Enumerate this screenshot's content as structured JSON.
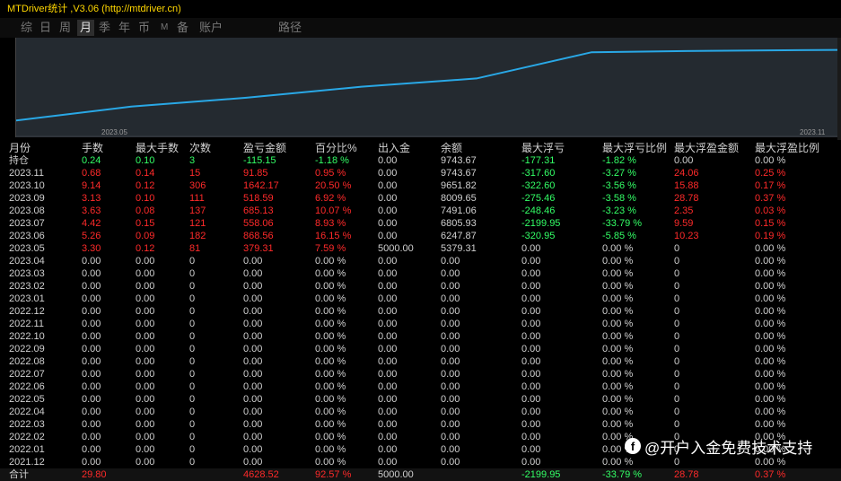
{
  "title": "MTDriver统计 ,V3.06 (http://mtdriver.cn)",
  "tabs": [
    "综",
    "日",
    "周",
    "月",
    "季",
    "年",
    "币",
    "M",
    "备",
    "账户",
    "路径"
  ],
  "active_tab": "月",
  "chart_data": {
    "type": "line",
    "x": [
      "2023.05",
      "2023.06",
      "2023.07",
      "2023.08",
      "2023.09",
      "2023.10",
      "2023.11"
    ],
    "y": [
      5379.31,
      6247.87,
      6805.93,
      7491.06,
      8009.65,
      9651.82,
      9743.67
    ],
    "xticks": [
      "2023.05",
      "2023.11"
    ],
    "color": "#29a8e6"
  },
  "table": {
    "headers": [
      "月份",
      "手数",
      "最大手数",
      "次数",
      "盈亏金额",
      "百分比%",
      "出入金",
      "余额",
      "最大浮亏",
      "最大浮亏比例",
      "最大浮盈金额",
      "最大浮盈比例"
    ],
    "rows": [
      [
        "持仓",
        "0.24",
        "0.10",
        "3",
        "-115.15",
        "-1.18 %",
        "0.00",
        "9743.67",
        "-177.31",
        "-1.82 %",
        "0.00",
        "0.00 %"
      ],
      [
        "2023.11",
        "0.68",
        "0.14",
        "15",
        "91.85",
        "0.95 %",
        "0.00",
        "9743.67",
        "-317.60",
        "-3.27 %",
        "24.06",
        "0.25 %"
      ],
      [
        "2023.10",
        "9.14",
        "0.12",
        "306",
        "1642.17",
        "20.50 %",
        "0.00",
        "9651.82",
        "-322.60",
        "-3.56 %",
        "15.88",
        "0.17 %"
      ],
      [
        "2023.09",
        "3.13",
        "0.10",
        "111",
        "518.59",
        "6.92 %",
        "0.00",
        "8009.65",
        "-275.46",
        "-3.58 %",
        "28.78",
        "0.37 %"
      ],
      [
        "2023.08",
        "3.63",
        "0.08",
        "137",
        "685.13",
        "10.07 %",
        "0.00",
        "7491.06",
        "-248.46",
        "-3.23 %",
        "2.35",
        "0.03 %"
      ],
      [
        "2023.07",
        "4.42",
        "0.15",
        "121",
        "558.06",
        "8.93 %",
        "0.00",
        "6805.93",
        "-2199.95",
        "-33.79 %",
        "9.59",
        "0.15 %"
      ],
      [
        "2023.06",
        "5.26",
        "0.09",
        "182",
        "868.56",
        "16.15 %",
        "0.00",
        "6247.87",
        "-320.95",
        "-5.85 %",
        "10.23",
        "0.19 %"
      ],
      [
        "2023.05",
        "3.30",
        "0.12",
        "81",
        "379.31",
        "7.59 %",
        "5000.00",
        "5379.31",
        "0.00",
        "0.00 %",
        "0",
        "0.00 %"
      ],
      [
        "2023.04",
        "0.00",
        "0.00",
        "0",
        "0.00",
        "0.00 %",
        "0.00",
        "0.00",
        "0.00",
        "0.00 %",
        "0",
        "0.00 %"
      ],
      [
        "2023.03",
        "0.00",
        "0.00",
        "0",
        "0.00",
        "0.00 %",
        "0.00",
        "0.00",
        "0.00",
        "0.00 %",
        "0",
        "0.00 %"
      ],
      [
        "2023.02",
        "0.00",
        "0.00",
        "0",
        "0.00",
        "0.00 %",
        "0.00",
        "0.00",
        "0.00",
        "0.00 %",
        "0",
        "0.00 %"
      ],
      [
        "2023.01",
        "0.00",
        "0.00",
        "0",
        "0.00",
        "0.00 %",
        "0.00",
        "0.00",
        "0.00",
        "0.00 %",
        "0",
        "0.00 %"
      ],
      [
        "2022.12",
        "0.00",
        "0.00",
        "0",
        "0.00",
        "0.00 %",
        "0.00",
        "0.00",
        "0.00",
        "0.00 %",
        "0",
        "0.00 %"
      ],
      [
        "2022.11",
        "0.00",
        "0.00",
        "0",
        "0.00",
        "0.00 %",
        "0.00",
        "0.00",
        "0.00",
        "0.00 %",
        "0",
        "0.00 %"
      ],
      [
        "2022.10",
        "0.00",
        "0.00",
        "0",
        "0.00",
        "0.00 %",
        "0.00",
        "0.00",
        "0.00",
        "0.00 %",
        "0",
        "0.00 %"
      ],
      [
        "2022.09",
        "0.00",
        "0.00",
        "0",
        "0.00",
        "0.00 %",
        "0.00",
        "0.00",
        "0.00",
        "0.00 %",
        "0",
        "0.00 %"
      ],
      [
        "2022.08",
        "0.00",
        "0.00",
        "0",
        "0.00",
        "0.00 %",
        "0.00",
        "0.00",
        "0.00",
        "0.00 %",
        "0",
        "0.00 %"
      ],
      [
        "2022.07",
        "0.00",
        "0.00",
        "0",
        "0.00",
        "0.00 %",
        "0.00",
        "0.00",
        "0.00",
        "0.00 %",
        "0",
        "0.00 %"
      ],
      [
        "2022.06",
        "0.00",
        "0.00",
        "0",
        "0.00",
        "0.00 %",
        "0.00",
        "0.00",
        "0.00",
        "0.00 %",
        "0",
        "0.00 %"
      ],
      [
        "2022.05",
        "0.00",
        "0.00",
        "0",
        "0.00",
        "0.00 %",
        "0.00",
        "0.00",
        "0.00",
        "0.00 %",
        "0",
        "0.00 %"
      ],
      [
        "2022.04",
        "0.00",
        "0.00",
        "0",
        "0.00",
        "0.00 %",
        "0.00",
        "0.00",
        "0.00",
        "0.00 %",
        "0",
        "0.00 %"
      ],
      [
        "2022.03",
        "0.00",
        "0.00",
        "0",
        "0.00",
        "0.00 %",
        "0.00",
        "0.00",
        "0.00",
        "0.00 %",
        "0",
        "0.00 %"
      ],
      [
        "2022.02",
        "0.00",
        "0.00",
        "0",
        "0.00",
        "0.00 %",
        "0.00",
        "0.00",
        "0.00",
        "0.00 %",
        "0",
        "0.00 %"
      ],
      [
        "2022.01",
        "0.00",
        "0.00",
        "0",
        "0.00",
        "0.00 %",
        "0.00",
        "0.00",
        "0.00",
        "0.00 %",
        "0",
        "0.00 %"
      ],
      [
        "2021.12",
        "0.00",
        "0.00",
        "0",
        "0.00",
        "0.00 %",
        "0.00",
        "0.00",
        "0.00",
        "0.00 %",
        "0",
        "0.00 %"
      ]
    ],
    "summary": [
      "合计",
      "29.80",
      "",
      "",
      "4628.52",
      "92.57 %",
      "5000.00",
      "",
      "-2199.95",
      "-33.79 %",
      "28.78",
      "0.37 %"
    ]
  },
  "colors": {
    "positive": "#ff2a2a",
    "negative": "#33ff66",
    "neutral": "#d0d0d0",
    "title": "#ffd700",
    "line": "#29a8e6"
  },
  "watermark": {
    "icon": "social-logo-icon",
    "icon_glyph": "f",
    "text": "@开户入金免费技术支持"
  }
}
